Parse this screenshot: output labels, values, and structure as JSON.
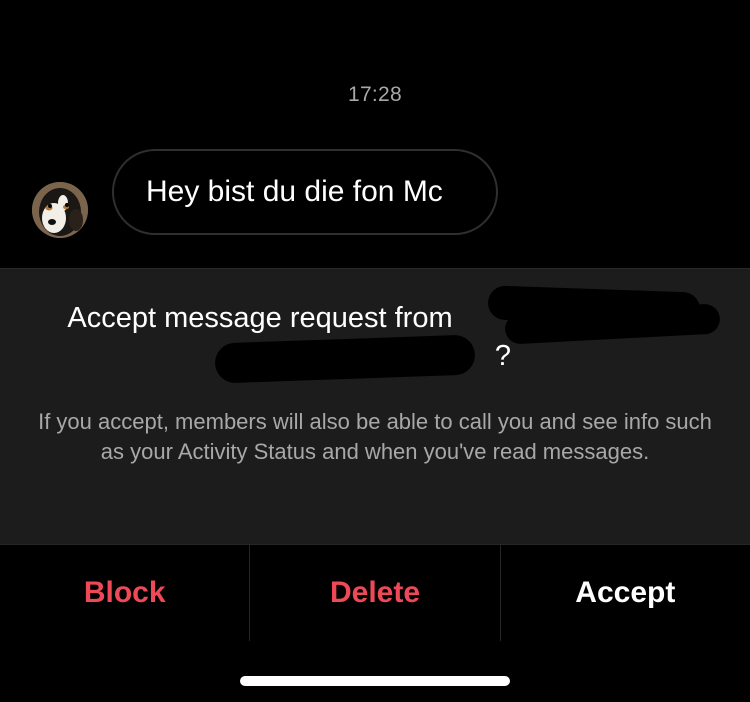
{
  "chat": {
    "timestamp": "17:28",
    "message": {
      "text": "Hey bist du die fon Mc",
      "sender_avatar": "dog-photo"
    }
  },
  "request": {
    "title": "Accept message request from [redacted] ([redacted])?",
    "title_visible_start": "Accept message request from",
    "title_visible_end": "?",
    "description": "If you accept, members will also be able to call you and see info such as your Activity Status and when you've read messages."
  },
  "actions": {
    "block_label": "Block",
    "delete_label": "Delete",
    "accept_label": "Accept"
  },
  "colors": {
    "background": "#000000",
    "panel": "#1c1c1c",
    "danger": "#ed4956",
    "muted_text": "#a8a8a8"
  }
}
